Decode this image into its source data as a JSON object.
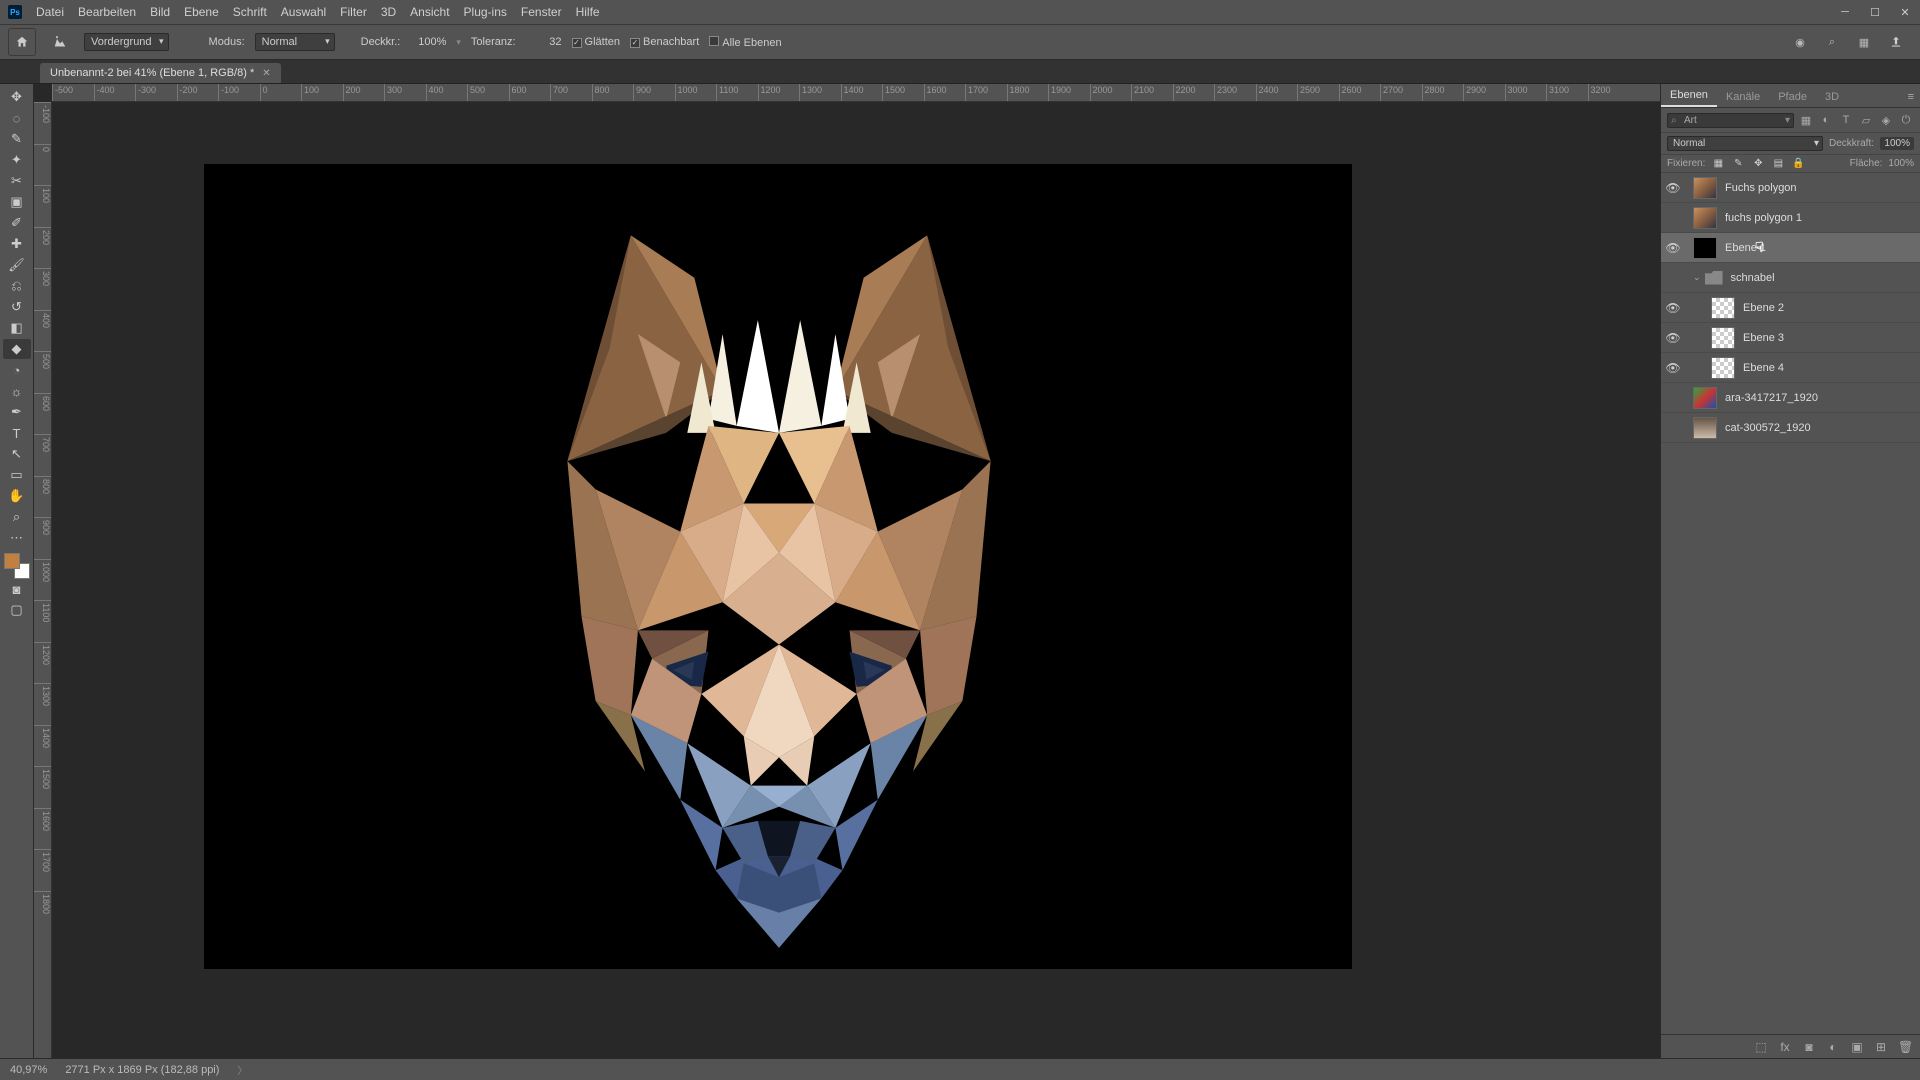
{
  "menu": [
    "Datei",
    "Bearbeiten",
    "Bild",
    "Ebene",
    "Schrift",
    "Auswahl",
    "Filter",
    "3D",
    "Ansicht",
    "Plug-ins",
    "Fenster",
    "Hilfe"
  ],
  "opt": {
    "preset": "Vordergrund",
    "mode_lbl": "Modus:",
    "mode": "Normal",
    "opacity_lbl": "Deckkr.:",
    "opacity": "100%",
    "tol_lbl": "Toleranz:",
    "tol": "32",
    "glatten": "Glätten",
    "benach": "Benachbart",
    "alle": "Alle Ebenen"
  },
  "doc_tab": "Unbenannt-2 bei 41% (Ebene 1, RGB/8) *",
  "ruler": [
    "-500",
    "-400",
    "-300",
    "-200",
    "-100",
    "0",
    "100",
    "200",
    "300",
    "400",
    "500",
    "600",
    "700",
    "800",
    "900",
    "1000",
    "1100",
    "1200",
    "1300",
    "1400",
    "1500",
    "1600",
    "1700",
    "1800",
    "1900",
    "2000",
    "2100",
    "2200",
    "2300",
    "2400",
    "2500",
    "2600",
    "2700",
    "2800",
    "2900",
    "3000",
    "3100",
    "3200"
  ],
  "ruler_v": [
    "-100",
    "0",
    "100",
    "200",
    "300",
    "400",
    "500",
    "600",
    "700",
    "800",
    "900",
    "1000",
    "1100",
    "1200",
    "1300",
    "1400",
    "1500",
    "1600",
    "1700",
    "1800"
  ],
  "panel_tabs": {
    "layers": "Ebenen",
    "channels": "Kanäle",
    "paths": "Pfade",
    "threeD": "3D"
  },
  "layer_panel": {
    "filter_placeholder": "Art",
    "blend": "Normal",
    "opacity_lbl": "Deckkraft:",
    "opacity": "100%",
    "lock_lbl": "Fixieren:",
    "fill_lbl": "Fläche:",
    "fill": "100%"
  },
  "layers": [
    {
      "name": "Fuchs polygon",
      "vis": true,
      "thumb": "fox",
      "indent": 0
    },
    {
      "name": "fuchs polygon 1",
      "vis": false,
      "thumb": "fox",
      "indent": 0
    },
    {
      "name": "Ebene 1",
      "vis": true,
      "thumb": "black",
      "indent": 0,
      "selected": true,
      "cursor": true
    },
    {
      "name": "schnabel",
      "vis": false,
      "folder": true,
      "indent": 0,
      "open": true
    },
    {
      "name": "Ebene 2",
      "vis": true,
      "thumb": "trans",
      "indent": 1
    },
    {
      "name": "Ebene 3",
      "vis": true,
      "thumb": "trans",
      "indent": 1
    },
    {
      "name": "Ebene 4",
      "vis": true,
      "thumb": "trans",
      "indent": 1
    },
    {
      "name": "ara-3417217_1920",
      "vis": false,
      "thumb": "bird",
      "indent": 0
    },
    {
      "name": "cat-300572_1920",
      "vis": false,
      "thumb": "cat",
      "indent": 0
    }
  ],
  "status": {
    "zoom": "40,97%",
    "dims": "2771 Px x 1869 Px (182,88 ppi)"
  },
  "swatch_fg": "#c08040"
}
